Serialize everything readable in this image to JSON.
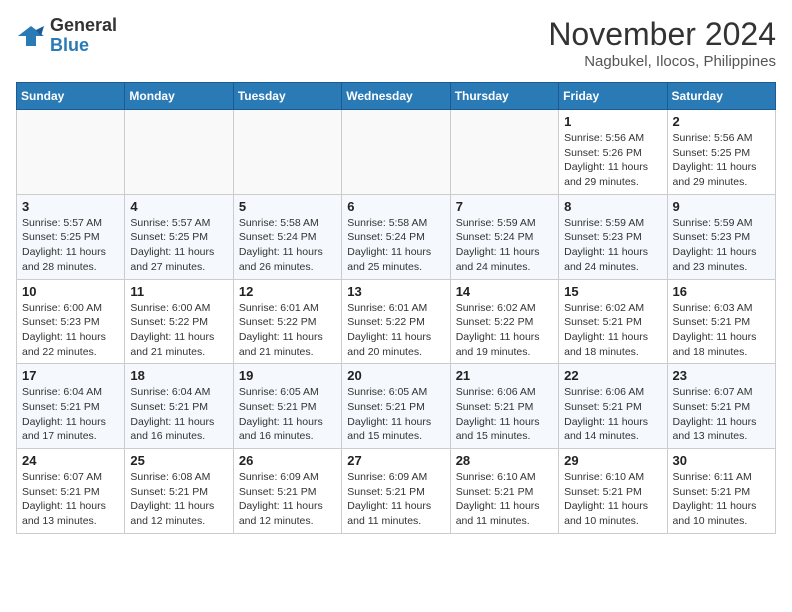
{
  "header": {
    "logo_general": "General",
    "logo_blue": "Blue",
    "month_title": "November 2024",
    "location": "Nagbukel, Ilocos, Philippines"
  },
  "weekdays": [
    "Sunday",
    "Monday",
    "Tuesday",
    "Wednesday",
    "Thursday",
    "Friday",
    "Saturday"
  ],
  "weeks": [
    [
      {
        "day": "",
        "info": ""
      },
      {
        "day": "",
        "info": ""
      },
      {
        "day": "",
        "info": ""
      },
      {
        "day": "",
        "info": ""
      },
      {
        "day": "",
        "info": ""
      },
      {
        "day": "1",
        "info": "Sunrise: 5:56 AM\nSunset: 5:26 PM\nDaylight: 11 hours and 29 minutes."
      },
      {
        "day": "2",
        "info": "Sunrise: 5:56 AM\nSunset: 5:25 PM\nDaylight: 11 hours and 29 minutes."
      }
    ],
    [
      {
        "day": "3",
        "info": "Sunrise: 5:57 AM\nSunset: 5:25 PM\nDaylight: 11 hours and 28 minutes."
      },
      {
        "day": "4",
        "info": "Sunrise: 5:57 AM\nSunset: 5:25 PM\nDaylight: 11 hours and 27 minutes."
      },
      {
        "day": "5",
        "info": "Sunrise: 5:58 AM\nSunset: 5:24 PM\nDaylight: 11 hours and 26 minutes."
      },
      {
        "day": "6",
        "info": "Sunrise: 5:58 AM\nSunset: 5:24 PM\nDaylight: 11 hours and 25 minutes."
      },
      {
        "day": "7",
        "info": "Sunrise: 5:59 AM\nSunset: 5:24 PM\nDaylight: 11 hours and 24 minutes."
      },
      {
        "day": "8",
        "info": "Sunrise: 5:59 AM\nSunset: 5:23 PM\nDaylight: 11 hours and 24 minutes."
      },
      {
        "day": "9",
        "info": "Sunrise: 5:59 AM\nSunset: 5:23 PM\nDaylight: 11 hours and 23 minutes."
      }
    ],
    [
      {
        "day": "10",
        "info": "Sunrise: 6:00 AM\nSunset: 5:23 PM\nDaylight: 11 hours and 22 minutes."
      },
      {
        "day": "11",
        "info": "Sunrise: 6:00 AM\nSunset: 5:22 PM\nDaylight: 11 hours and 21 minutes."
      },
      {
        "day": "12",
        "info": "Sunrise: 6:01 AM\nSunset: 5:22 PM\nDaylight: 11 hours and 21 minutes."
      },
      {
        "day": "13",
        "info": "Sunrise: 6:01 AM\nSunset: 5:22 PM\nDaylight: 11 hours and 20 minutes."
      },
      {
        "day": "14",
        "info": "Sunrise: 6:02 AM\nSunset: 5:22 PM\nDaylight: 11 hours and 19 minutes."
      },
      {
        "day": "15",
        "info": "Sunrise: 6:02 AM\nSunset: 5:21 PM\nDaylight: 11 hours and 18 minutes."
      },
      {
        "day": "16",
        "info": "Sunrise: 6:03 AM\nSunset: 5:21 PM\nDaylight: 11 hours and 18 minutes."
      }
    ],
    [
      {
        "day": "17",
        "info": "Sunrise: 6:04 AM\nSunset: 5:21 PM\nDaylight: 11 hours and 17 minutes."
      },
      {
        "day": "18",
        "info": "Sunrise: 6:04 AM\nSunset: 5:21 PM\nDaylight: 11 hours and 16 minutes."
      },
      {
        "day": "19",
        "info": "Sunrise: 6:05 AM\nSunset: 5:21 PM\nDaylight: 11 hours and 16 minutes."
      },
      {
        "day": "20",
        "info": "Sunrise: 6:05 AM\nSunset: 5:21 PM\nDaylight: 11 hours and 15 minutes."
      },
      {
        "day": "21",
        "info": "Sunrise: 6:06 AM\nSunset: 5:21 PM\nDaylight: 11 hours and 15 minutes."
      },
      {
        "day": "22",
        "info": "Sunrise: 6:06 AM\nSunset: 5:21 PM\nDaylight: 11 hours and 14 minutes."
      },
      {
        "day": "23",
        "info": "Sunrise: 6:07 AM\nSunset: 5:21 PM\nDaylight: 11 hours and 13 minutes."
      }
    ],
    [
      {
        "day": "24",
        "info": "Sunrise: 6:07 AM\nSunset: 5:21 PM\nDaylight: 11 hours and 13 minutes."
      },
      {
        "day": "25",
        "info": "Sunrise: 6:08 AM\nSunset: 5:21 PM\nDaylight: 11 hours and 12 minutes."
      },
      {
        "day": "26",
        "info": "Sunrise: 6:09 AM\nSunset: 5:21 PM\nDaylight: 11 hours and 12 minutes."
      },
      {
        "day": "27",
        "info": "Sunrise: 6:09 AM\nSunset: 5:21 PM\nDaylight: 11 hours and 11 minutes."
      },
      {
        "day": "28",
        "info": "Sunrise: 6:10 AM\nSunset: 5:21 PM\nDaylight: 11 hours and 11 minutes."
      },
      {
        "day": "29",
        "info": "Sunrise: 6:10 AM\nSunset: 5:21 PM\nDaylight: 11 hours and 10 minutes."
      },
      {
        "day": "30",
        "info": "Sunrise: 6:11 AM\nSunset: 5:21 PM\nDaylight: 11 hours and 10 minutes."
      }
    ]
  ]
}
